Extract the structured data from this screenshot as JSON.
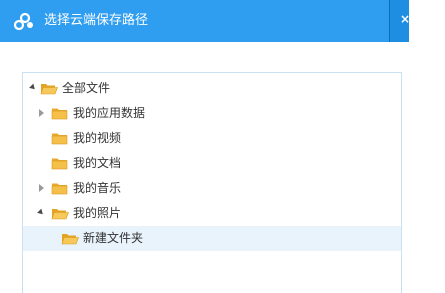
{
  "dialog": {
    "title": "选择云端保存路径",
    "close_glyph": "×"
  },
  "tree": {
    "root": {
      "label": "全部文件",
      "expanded": true
    },
    "items": [
      {
        "label": "我的应用数据",
        "has_children": true,
        "expanded": false
      },
      {
        "label": "我的视频",
        "has_children": false
      },
      {
        "label": "我的文档",
        "has_children": false
      },
      {
        "label": "我的音乐",
        "has_children": true,
        "expanded": false
      },
      {
        "label": "我的照片",
        "has_children": true,
        "expanded": true
      },
      {
        "label": "新建文件夹",
        "has_children": false,
        "selected": true,
        "parent": "我的照片"
      }
    ]
  },
  "colors": {
    "titlebar": "#2f9df0",
    "folder": "#f0b73e",
    "selected_row": "#e8f3fc"
  },
  "icons": {
    "logo": "baidu-cloud-logo-icon",
    "folder": "folder-icon",
    "open_folder": "folder-open-icon"
  }
}
